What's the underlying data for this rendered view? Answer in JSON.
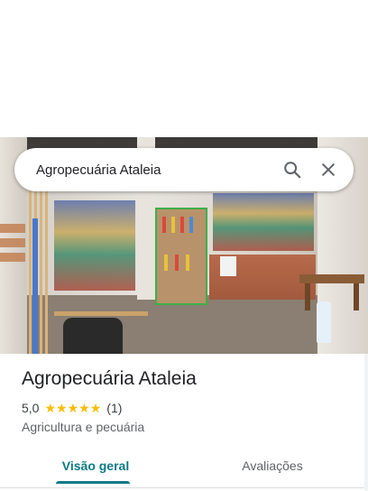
{
  "search": {
    "query": "Agropecuária Ataleia"
  },
  "place": {
    "name": "Agropecuária Ataleia",
    "rating_value": "5,0",
    "stars": [
      "★",
      "★",
      "★",
      "★",
      "★"
    ],
    "review_count": "(1)",
    "category": "Agricultura e pecuária"
  },
  "tabs": [
    {
      "label": "Visão geral",
      "selected": true
    },
    {
      "label": "Avaliações",
      "selected": false
    }
  ],
  "icons": {
    "search": "search-icon",
    "close": "close-icon",
    "star": "star-icon"
  },
  "colors": {
    "accent": "#0b7a85",
    "star": "#fbbc04",
    "text_primary": "#202124",
    "text_secondary": "#5f6368"
  }
}
